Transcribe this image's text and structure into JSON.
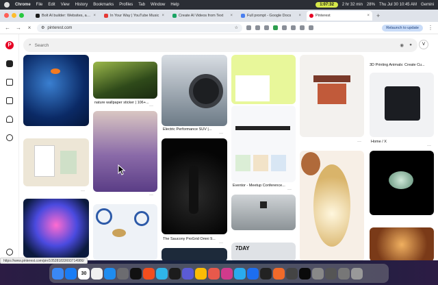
{
  "menubar": {
    "items": [
      "Chrome",
      "File",
      "Edit",
      "View",
      "History",
      "Bookmarks",
      "Profiles",
      "Tab",
      "Window",
      "Help"
    ],
    "timer": "1:07:32",
    "battery": "2 hr 32 min",
    "battery_pct": "28%",
    "datetime": "Thu Jul 30  10:45 AM",
    "gemini": "Gemini"
  },
  "tabs": [
    {
      "title": "Bolt AI builder: Websites, apps",
      "color": "#1a1a1a",
      "active": false
    },
    {
      "title": "In Your Way | YouTube Music",
      "color": "#e53935",
      "active": false
    },
    {
      "title": "Create AI Videos from Text",
      "color": "#19a463",
      "active": false
    },
    {
      "title": "Full prompt - Google Docs",
      "color": "#4a7ff0",
      "active": false
    },
    {
      "title": "Pinterest",
      "color": "#e60023",
      "active": true
    }
  ],
  "toolbar": {
    "url": "pinterest.com",
    "relaunch": "Relaunch to update"
  },
  "search": {
    "placeholder": "Search"
  },
  "avatar": "V",
  "pins": {
    "c1_top_cap": "",
    "c2_top_cap": "nature wallpaper sticker | 106+...",
    "c2_title_above": "",
    "c3_cap": "Electric Performance SUV |...",
    "c3_bottom_cap": "The Saucony ProGrid Omni 9...",
    "c4_cap": "Eventor - Meetup Conference...",
    "c4_day": "7DAY",
    "c5_top_cap": "3D Printing Animals: Create Cu...",
    "c5_bottom_cap": "Home / X"
  },
  "status_url": "https://www.pinterest.com/pin/105281833693714986/",
  "dock_date": "30"
}
